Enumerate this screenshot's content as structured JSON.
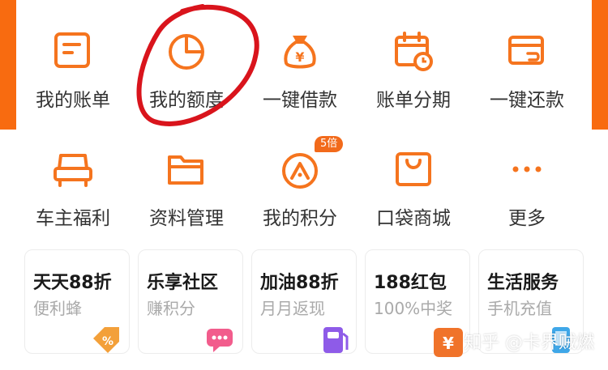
{
  "colors": {
    "accent": "#F5741E",
    "edge": "#F86B10",
    "annotation": "#D9141C",
    "badge": "#F26A1B"
  },
  "menu": {
    "row1": [
      {
        "label": "我的账单",
        "icon": "bill-icon"
      },
      {
        "label": "我的额度",
        "icon": "pie-chart-icon"
      },
      {
        "label": "一键借款",
        "icon": "money-bag-icon"
      },
      {
        "label": "账单分期",
        "icon": "calendar-clock-icon"
      },
      {
        "label": "一键还款",
        "icon": "card-return-icon"
      }
    ],
    "row2": [
      {
        "label": "车主福利",
        "icon": "car-seat-icon"
      },
      {
        "label": "资料管理",
        "icon": "folder-icon"
      },
      {
        "label": "我的积分",
        "icon": "points-icon",
        "badge": "5倍"
      },
      {
        "label": "口袋商城",
        "icon": "shopping-bag-icon"
      },
      {
        "label": "更多",
        "icon": "more-dots-icon"
      }
    ]
  },
  "cards": [
    {
      "title": "天天88折",
      "sub": "便利蜂",
      "icon": "discount-tag-icon"
    },
    {
      "title": "乐享社区",
      "sub": "赚积分",
      "icon": "chat-bubble-icon"
    },
    {
      "title": "加油88折",
      "sub": "月月返现",
      "icon": "fuel-icon"
    },
    {
      "title": "188红包",
      "sub": "100%中奖",
      "icon": "red-packet-icon"
    },
    {
      "title": "生活服务",
      "sub": "手机充值",
      "icon": "phone-service-icon"
    }
  ],
  "watermark": {
    "text": "知乎 @卡界贼燃"
  }
}
